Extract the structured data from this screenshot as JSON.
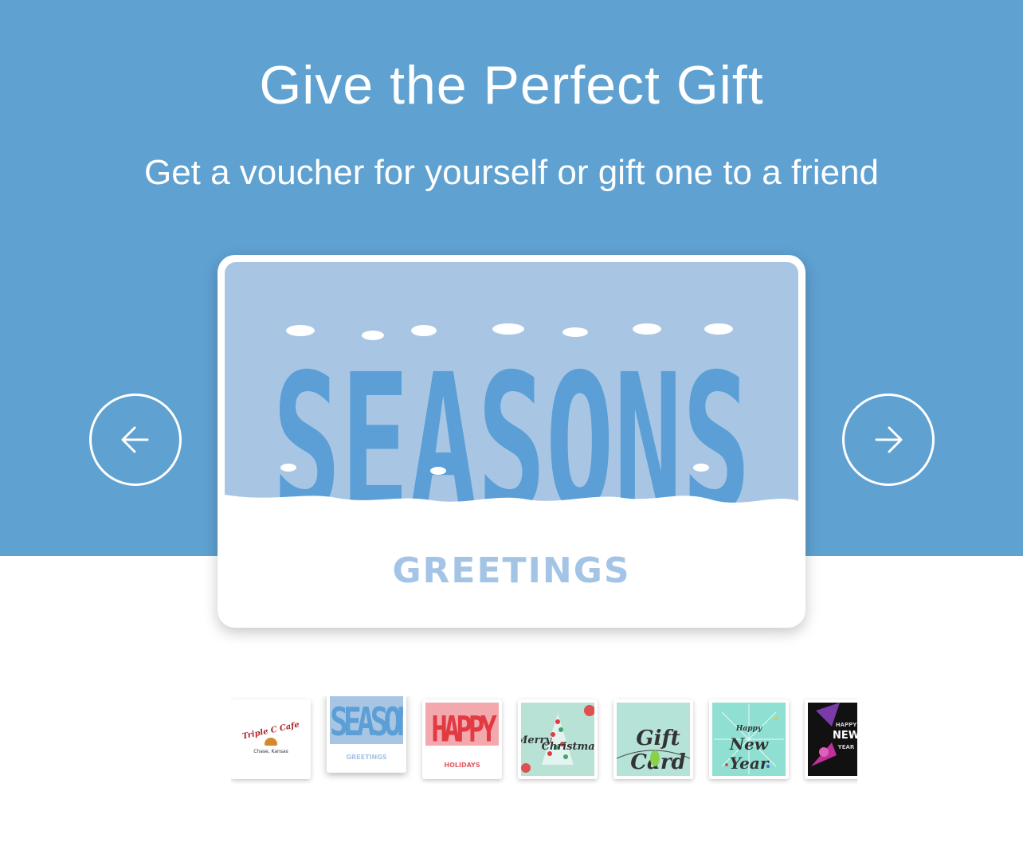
{
  "hero": {
    "title": "Give the Perfect Gift",
    "subtitle": "Get a voucher for yourself or gift one to a friend",
    "background_color": "#5fa1d1"
  },
  "carousel": {
    "prev_icon": "arrow-left-icon",
    "next_icon": "arrow-right-icon",
    "selected_index": 1,
    "selected_card": {
      "headline": "SEASONS",
      "greeting": "GREETINGS"
    }
  },
  "thumbnails": [
    {
      "name": "triple-c-cafe",
      "line1": "Triple C Cafe",
      "line2": "Chase, Kansas"
    },
    {
      "name": "seasons-greetings",
      "line1": "SEASON",
      "line2": "GREETINGS"
    },
    {
      "name": "happy-holidays",
      "line1": "HAPPY",
      "line2": "HOLIDAYS"
    },
    {
      "name": "merry-christmas",
      "line1": "Merry",
      "line2": "Christmas"
    },
    {
      "name": "gift-card",
      "line1": "Gift Card"
    },
    {
      "name": "happy-new-year",
      "line1": "Happy",
      "line2": "New Year"
    },
    {
      "name": "happy-new-year-dark",
      "line1": "HAPPY",
      "line2": "NEW",
      "line3": "YEAR"
    }
  ]
}
